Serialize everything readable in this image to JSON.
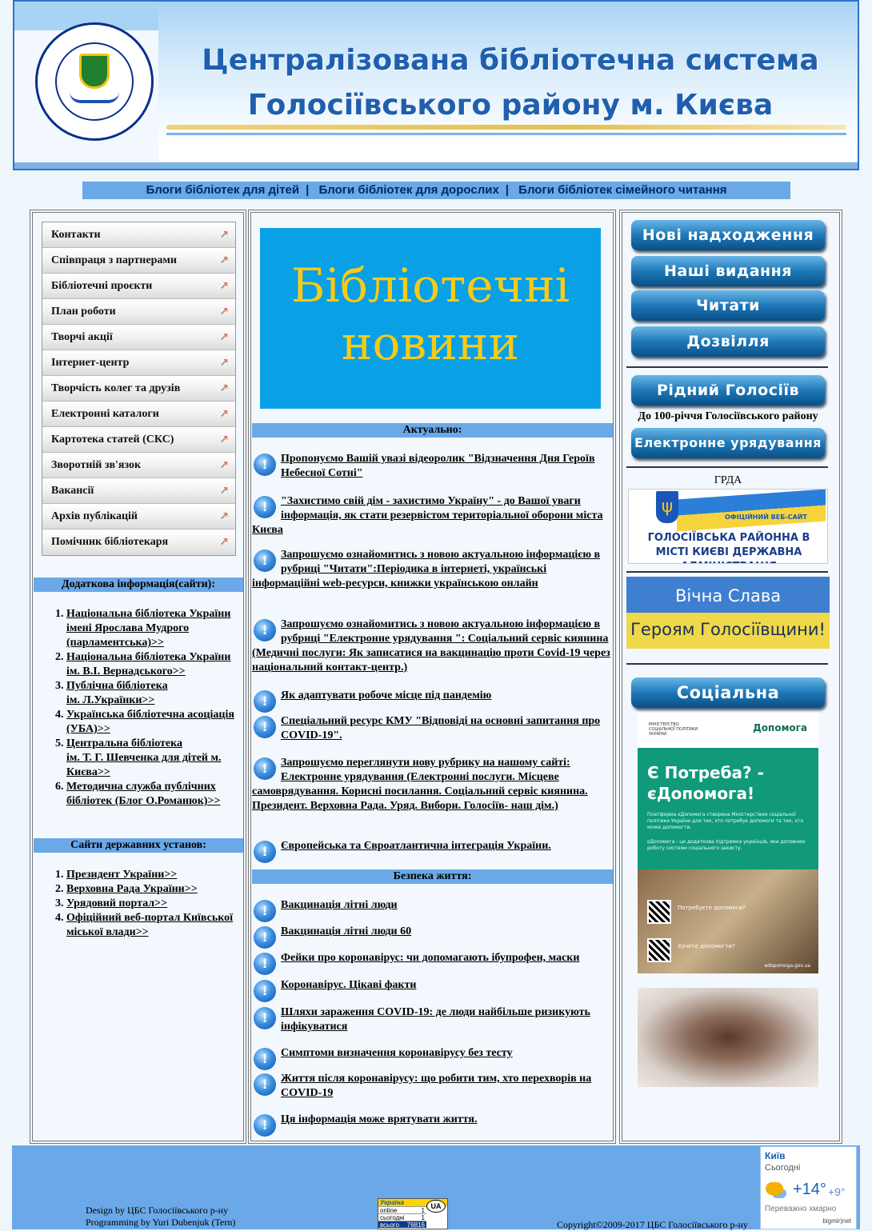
{
  "header": {
    "title_line1": "Централізована бібліотечна система",
    "title_line2": "Голосіївського району м. Києва",
    "seal_text": "Централізована бібліотечна система Голосіївського району м. Києва"
  },
  "top_nav": {
    "items": [
      "Блоги бібліотек для дітей",
      "Блоги бібліотек для дорослих",
      "Блоги бібліотек сімейного читання"
    ],
    "separator": "|"
  },
  "left_menu": {
    "arrow_glyph": "↗",
    "items": [
      "Контакти",
      "Співпраця з партнерами",
      "Бібліотечні проєкти",
      "План роботи",
      "Творчі акції",
      "Інтернет-центр",
      "Творчість колег та друзів",
      "Електронні каталоги",
      "Картотека статей (СКС)",
      "Зворотній зв'язок",
      "Вакансії",
      "Архів публікацій",
      "Помічник бібліотекаря"
    ]
  },
  "extra_info": {
    "heading": "Додаткова інформація(сайти):",
    "links": [
      "Національна бібліотека України імені Ярослава Мудрого (парламентська)>>",
      "Національна бібліотека України\nім. В.І. Вернадського>>",
      "Публічна бібліотека\nім. Л.Українки>>",
      "Українська бібліотечна асоціація (УБА)>>",
      "Центральна бібліотека\nім. Т. Г. Шевченка для дітей м. Києва>>",
      "Методична служба публічних бібліотек (Блог О.Романюк)>>"
    ]
  },
  "gov_sites": {
    "heading": "Сайти державних установ:",
    "links": [
      "Президент України>>",
      "Верховна Рада України>>",
      "Урядовий портал>>",
      "Офіційний веб-портал Київської міської влади>>"
    ]
  },
  "news_banner": {
    "line1": "Бібліотечні",
    "line2": "новини"
  },
  "actual": {
    "heading": "Актуально:",
    "bullet_glyph": "!",
    "items": [
      "Пропонуємо Вашій увазі відеоролик \"Відзначення Дня Героїв Небесної Сотні\"",
      "\"Захистимо свій дім - захистимо Україну\" - до Вашої уваги інформація, як стати резервістом територіальної оборони міста Києва",
      "Запрошуємо ознайомитись з новою актуальною інформацією в рубриці \"Читати\":Періодика в інтернеті, українські інформаційні web-ресурси, книжки українською онлайн",
      "Запрошуємо ознайомитись з новою актуальною інформацією в рубриці \"Електронне урядування \": Соціальний сервіс киянина (Медичні послуги: Як записатися на вакцинацію проти Covid-19 через національний контакт-центр.)",
      "Як адаптувати робоче місце під пандемію",
      "Спеціальний ресурс КМУ \"Відповіді на основні запитання про COVID-19\".",
      "Запрошуємо переглянути нову рубрику на нашому сайті: Електронне урядування (Електронні послуги. Місцеве самоврядування. Корисні посилання. Соціальний сервіс киянина. Президент. Верховна Рада. Уряд. Вибори. Голосіїв- наш дім.)",
      "Європейська та Євроатлантична інтеграція України."
    ]
  },
  "safety": {
    "heading": "Безпека життя:",
    "items": [
      "Вакцинація літні люди",
      "Вакцинація літні люди 60",
      "Фейки про коронавірус: чи допомагають ібупрофен, маски",
      "Коронавірус. Цікаві факти",
      "Шляхи зараження COVID-19: де люди найбільше ризикують інфікуватися",
      "Симптоми визначення коронавірусу без тесту",
      "Життя після коронавірусу: що робити тим, хто перехворів на COVID-19",
      "Ця інформація може врятувати життя."
    ]
  },
  "right": {
    "buttons": [
      "Нові надходження",
      "Наші видання",
      "Читати",
      "Дозвілля"
    ],
    "native_button": "Рідний Голосіїв",
    "centenary_caption": "До 100-річчя Голосіївського району",
    "egov_button": "Електронне урядування",
    "grda_label": "ГРДА",
    "grda_banner_small": "ОФІЦІЙНИЙ ВЕБ-САЙТ",
    "grda_banner_big": "ГОЛОСІЇВСЬКА РАЙОННА В МІСТІ КИЄВІ ДЕРЖАВНА АДМІНІСТРАЦІЯ",
    "glory_line1": "Вічна Слава",
    "glory_line2": "Героям Голосіївщини!",
    "social_button": "Соціальна  реклама",
    "dopomoga": {
      "ministry": "МІНІСТЕРСТВО СОЦІАЛЬНОЇ ПОЛІТИКИ УКРАЇНИ",
      "brand": "Допомога",
      "title": "Є Потреба? - єДопомога!",
      "body1": "Платформа єДопомога створена Міністерством соціальної політики України для тих, хто потребує допомоги та тих, хто може допомогти.",
      "body2": "єДопомога - це додаткова підтримка українців, яка доповнює роботу системи соціального захисту.",
      "qr1": "Потребуєте допомоги?",
      "qr2": "Хочете допомогти?",
      "url": "edopomoga.gov.ua"
    }
  },
  "footer": {
    "design": "Design by ЦБС Голосіївського р-ну",
    "programming": "Programming by Yuri Dubenjuk (Tern)",
    "copyright": "Copyright©2009-2017 ЦБС Голосіївського р-ну",
    "counter": {
      "head": "Україна",
      "badge": "UA",
      "rows": [
        {
          "label": "online",
          "value": "1"
        },
        {
          "label": "сьогодні",
          "value": "1"
        },
        {
          "label": "всього",
          "value": "76816"
        }
      ]
    },
    "weather": {
      "city": "Київ",
      "day": "Сьогодні",
      "temp_high": "+14°",
      "temp_low": "+9°",
      "desc": "Переважно хмарно",
      "brand": "bigmir)net"
    }
  }
}
